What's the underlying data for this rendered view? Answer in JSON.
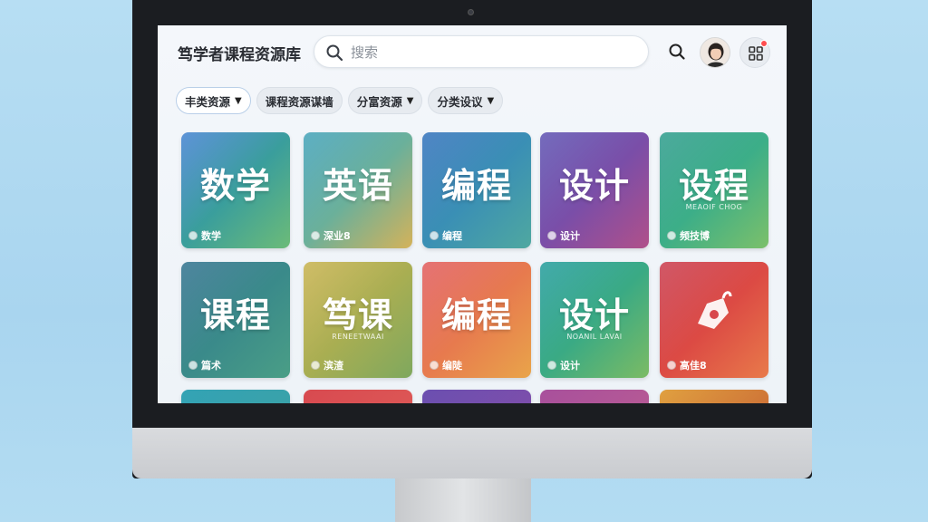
{
  "app": {
    "title": "笃学者课程资源库"
  },
  "search": {
    "placeholder": "搜索",
    "icon": "search-icon"
  },
  "header": {
    "search_icon": "search-icon",
    "avatar": "user-avatar",
    "menu_icon": "grid-icon",
    "notification_color": "#ff4d4f"
  },
  "filters": [
    {
      "label": "丰类资源",
      "active": true
    },
    {
      "label": "课程资源谋墙",
      "active": false
    },
    {
      "label": "分富资源",
      "active": false
    },
    {
      "label": "分类设议",
      "active": false
    }
  ],
  "cards": [
    {
      "title": "数学",
      "subtitle": "",
      "footer": "数学",
      "colors": [
        "#3f7fd0",
        "#3a9e9c",
        "#6cbb78"
      ]
    },
    {
      "title": "英语",
      "subtitle": "",
      "footer": "深业8",
      "colors": [
        "#3fa0b8",
        "#6bb09a",
        "#d4b25a"
      ]
    },
    {
      "title": "编程",
      "subtitle": "",
      "footer": "编程",
      "colors": [
        "#2f6fba",
        "#3a8fb5",
        "#4fa8a0"
      ]
    },
    {
      "title": "设计",
      "subtitle": "",
      "footer": "设计",
      "colors": [
        "#5a4fb0",
        "#7a4ea8",
        "#b0508a"
      ]
    },
    {
      "title": "设程",
      "subtitle": "MEAOIF CHOG",
      "footer": "频技博",
      "colors": [
        "#2a9a8a",
        "#3cae88",
        "#7cc06a"
      ]
    },
    {
      "title": "课程",
      "subtitle": "",
      "footer": "篇术",
      "colors": [
        "#2d6f8c",
        "#3a8a8a",
        "#4a9e86"
      ]
    },
    {
      "title": "笃课",
      "subtitle": "RENEETWAAI",
      "footer": "滨渣",
      "colors": [
        "#c6b04a",
        "#a9ae52",
        "#7fa85e"
      ]
    },
    {
      "title": "编程",
      "subtitle": "",
      "footer": "编陡",
      "colors": [
        "#e0585a",
        "#e77a4e",
        "#e9a44a"
      ]
    },
    {
      "title": "设计",
      "subtitle": "NOANIL LAVAI",
      "footer": "设计",
      "colors": [
        "#1f9a9a",
        "#3aaa84",
        "#7bbb64"
      ]
    },
    {
      "title": "",
      "subtitle": "",
      "footer": "高佳8",
      "colors": [
        "#c8384a",
        "#dc4a44",
        "#e87a4a"
      ]
    }
  ],
  "partial_cards": [
    {
      "colors": [
        "#33a3b5",
        "#3fa0a0"
      ]
    },
    {
      "colors": [
        "#d84a50",
        "#e0605a"
      ]
    },
    {
      "colors": [
        "#6b4fb0",
        "#8a4ea8"
      ]
    },
    {
      "colors": [
        "#a8509c",
        "#c06090"
      ]
    },
    {
      "colors": [
        "#e0a040",
        "#c05030"
      ]
    }
  ]
}
